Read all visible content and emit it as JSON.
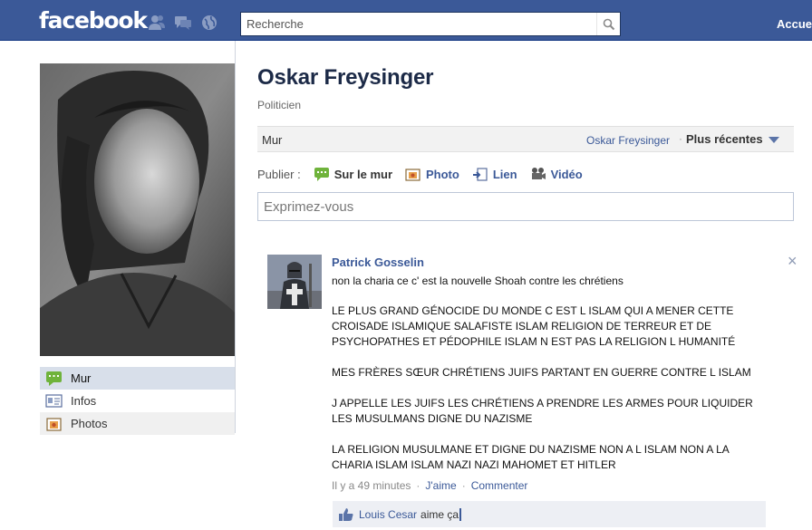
{
  "topbar": {
    "logo": "facebook",
    "search_placeholder": "Recherche",
    "home_link": "Accueil",
    "jewels": [
      "friend-requests-icon",
      "messages-icon",
      "notifications-icon"
    ]
  },
  "profile": {
    "name": "Oskar Freysinger",
    "category": "Politicien"
  },
  "side_nav": {
    "items": [
      {
        "label": "Mur",
        "icon": "wall-icon",
        "active": true
      },
      {
        "label": "Infos",
        "icon": "info-icon"
      },
      {
        "label": "Photos",
        "icon": "photos-icon"
      }
    ]
  },
  "wall": {
    "tab_label": "Mur",
    "filter_owner": "Oskar Freysinger",
    "separator": "·",
    "filter_sort": "Plus récentes"
  },
  "publisher": {
    "label": "Publier :",
    "items": [
      {
        "label": "Sur le mur",
        "icon": "status-icon",
        "active": true
      },
      {
        "label": "Photo",
        "icon": "photo-icon"
      },
      {
        "label": "Lien",
        "icon": "link-icon"
      },
      {
        "label": "Vidéo",
        "icon": "video-icon"
      }
    ],
    "placeholder": "Exprimez-vous"
  },
  "story": {
    "author": "Patrick Gosselin",
    "close_label": "×",
    "paragraphs": [
      "non la charia ce c' est la nouvelle Shoah contre les chrétiens",
      "LE PLUS GRAND GÉNOCIDE DU MONDE C EST L ISLAM QUI A MENER CETTE CROISADE ISLAMIQUE SALAFISTE ISLAM RELIGION DE TERREUR ET DE PSYCHOPATHES ET PÉDOPHILE ISLAM N EST PAS LA RELIGION L HUMANITÉ",
      "MES FRÈRES SŒUR CHRÉTIENS JUIFS PARTANT EN GUERRE CONTRE L ISLAM",
      "J APPELLE LES JUIFS LES CHRÉTIENS A PRENDRE LES ARMES POUR LIQUIDER LES MUSULMANS DIGNE DU NAZISME",
      "LA RELIGION MUSULMANE ET DIGNE DU NAZISME NON A L ISLAM NON A LA CHARIA ISLAM ISLAM NAZI NAZI MAHOMET ET HITLER"
    ],
    "timestamp": "Il y a 49 minutes",
    "dot": "·",
    "like_link": "J'aime",
    "comment_link": "Commenter",
    "likes_user": "Louis Cesar",
    "likes_text": "aime ça"
  },
  "colors": {
    "brand": "#3b5998",
    "link": "#3b5998",
    "like_bg": "#edeff4"
  }
}
